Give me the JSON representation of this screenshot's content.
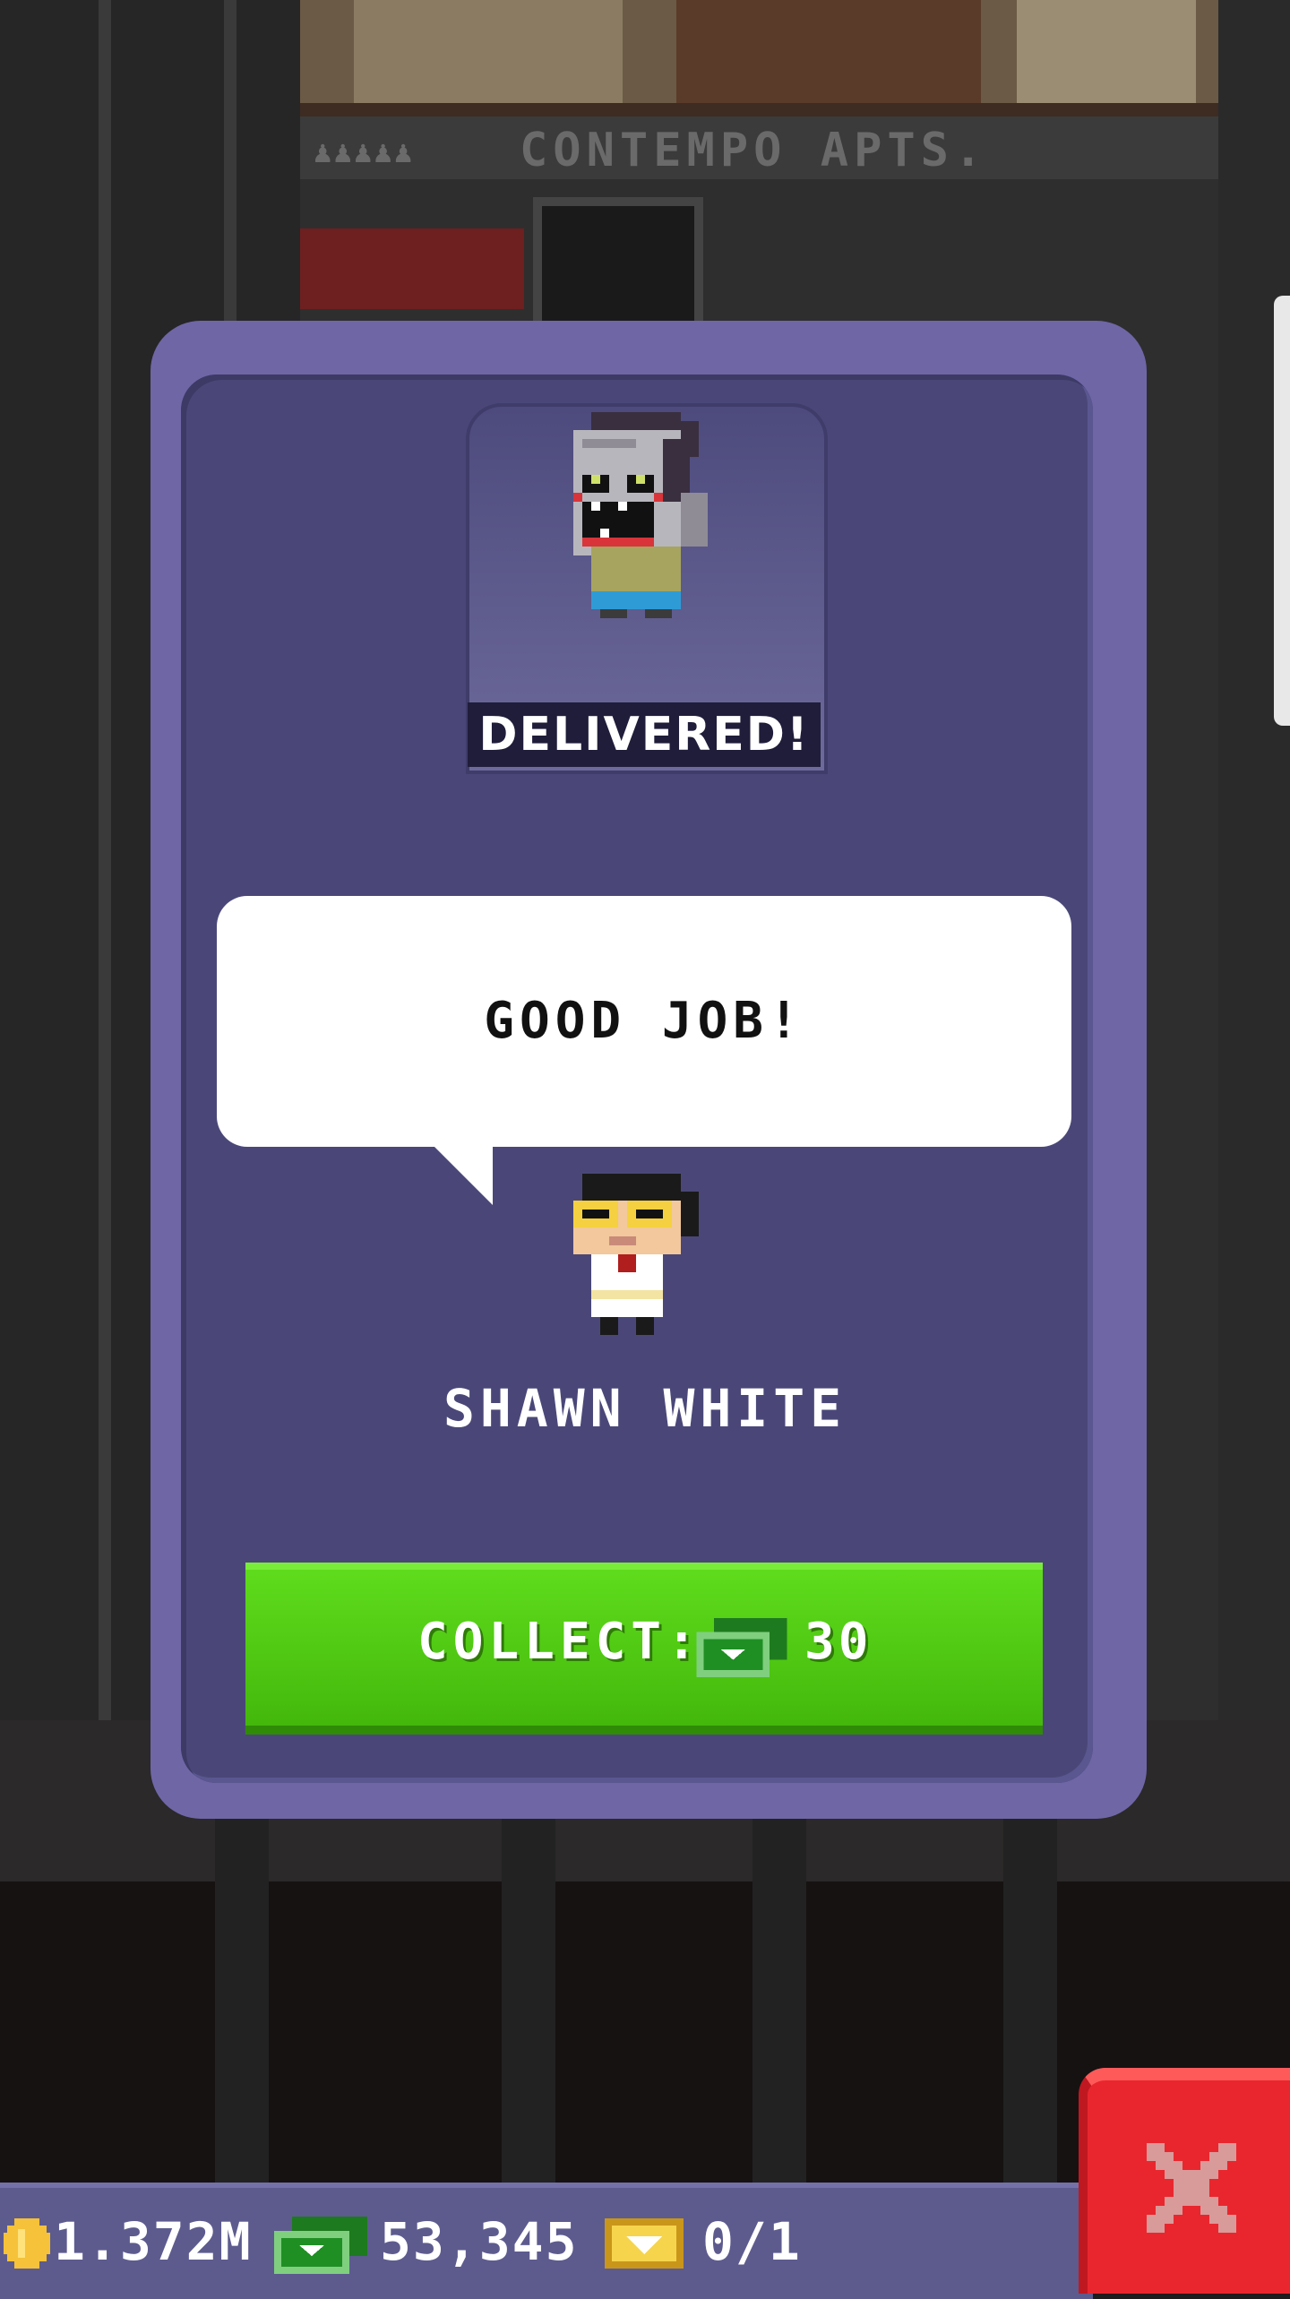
{
  "scene": {
    "building_sign": "CONTEMPO APTS."
  },
  "popup": {
    "status_label": "DELIVERED!",
    "speech": "GOOD JOB!",
    "character_name": "SHAWN WHITE",
    "collect": {
      "label": "COLLECT:",
      "currency_icon": "cash-icon",
      "amount": "30"
    }
  },
  "hud": {
    "coins": "1.372M",
    "bux": "53,345",
    "tickets": "0/1"
  },
  "colors": {
    "panel": "#4a4778",
    "panel_border": "#6f66a6",
    "collect_green": "#4cc814",
    "close_red": "#e9262e"
  }
}
